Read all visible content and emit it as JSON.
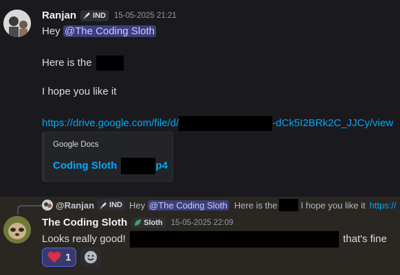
{
  "message1": {
    "username": "Ranjan",
    "tag": "IND",
    "timestamp": "15-05-2025 21:21",
    "greeting": "Hey",
    "mention": "@The Coding Sloth",
    "line2": "Here is the",
    "line3": "I hope you like it",
    "link_prefix": "https://drive.google.com/file/d/",
    "link_suffix": "-dCk5I2BRk2C_JJCy/view",
    "embed": {
      "provider": "Google Docs",
      "title_prefix": "Coding Sloth",
      "title_suffix": "p4"
    }
  },
  "reply_preview": {
    "author": "@Ranjan",
    "tag": "IND",
    "text_hey": "Hey",
    "mention": "@The Coding Sloth",
    "text_here": "Here is the",
    "text_hope": "I hope you like it",
    "link": "https://"
  },
  "message2": {
    "username": "The Coding Sloth",
    "tag": "Sloth",
    "timestamp": "15-05-2025 22:09",
    "text_start": "Looks really good!",
    "text_end": "that's fine",
    "reactions": [
      {
        "emoji": "heart-icon",
        "count": "1"
      }
    ]
  },
  "colors": {
    "background": "#1a1a1e",
    "reply_highlight": "#2a2621",
    "mention_bg": "#3b3f7a",
    "link": "#00a8fc",
    "reaction_border": "#5865f2"
  }
}
